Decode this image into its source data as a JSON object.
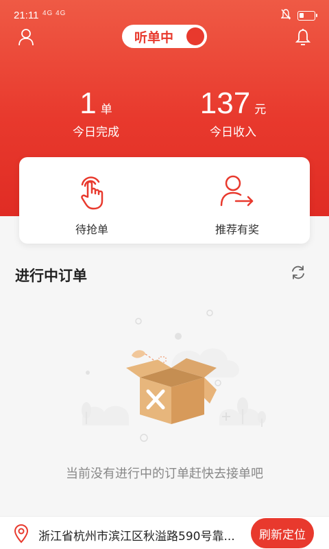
{
  "status_bar": {
    "time": "21:11",
    "network_labels": "4G 4G",
    "battery_level": 0.3
  },
  "header": {
    "profile_icon": "user-icon",
    "bell_icon": "bell-icon",
    "listening_toggle": {
      "label": "听单中",
      "on": true
    }
  },
  "stats": {
    "orders": {
      "value": "1",
      "unit": "单",
      "label": "今日完成"
    },
    "income": {
      "value": "137",
      "unit": "元",
      "label": "今日收入"
    }
  },
  "actions": {
    "grab": {
      "label": "待抢单",
      "icon": "tap-hand-icon"
    },
    "refer": {
      "label": "推荐有奖",
      "icon": "user-share-icon"
    }
  },
  "orders_section": {
    "title": "进行中订单",
    "refresh_icon": "refresh-icon",
    "empty_text": "当前没有进行中的订单赶快去接单吧"
  },
  "bottom": {
    "address": "浙江省杭州市滨江区秋溢路590号靠...",
    "relocate_label": "刷新定位"
  },
  "colors": {
    "primary": "#e8392d",
    "header_top": "#ef5a45",
    "text_muted": "#888888"
  }
}
